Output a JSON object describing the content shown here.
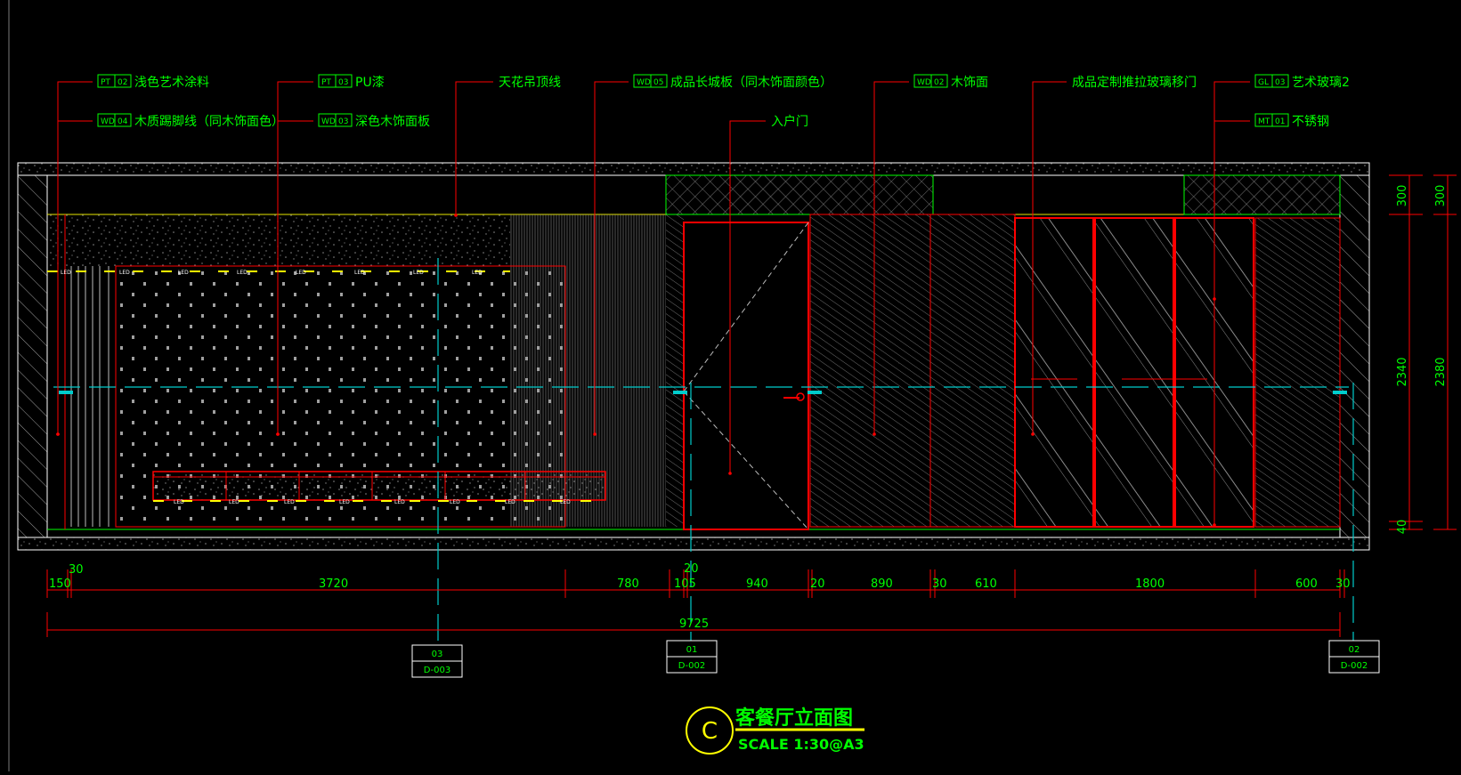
{
  "drawing": {
    "title": "客餐厅立面图",
    "scale": "SCALE 1:30@A3",
    "section_letter": "C",
    "led_label": "LED"
  },
  "callouts": [
    {
      "code": "PT",
      "num": "02",
      "text": "浅色艺术涂料"
    },
    {
      "code": "WD",
      "num": "04",
      "text": "木质踢脚线（同木饰面色）"
    },
    {
      "code": "PT",
      "num": "03",
      "text": "PU漆"
    },
    {
      "code": "WD",
      "num": "03",
      "text": "深色木饰面板"
    },
    {
      "code": "",
      "num": "",
      "text": "天花吊顶线"
    },
    {
      "code": "WD",
      "num": "05",
      "text": "成品长城板（同木饰面颜色）"
    },
    {
      "code": "",
      "num": "",
      "text": "入户门"
    },
    {
      "code": "WD",
      "num": "02",
      "text": "木饰面"
    },
    {
      "code": "",
      "num": "",
      "text": "成品定制推拉玻璃移门"
    },
    {
      "code": "GL",
      "num": "03",
      "text": "艺术玻璃2"
    },
    {
      "code": "MT",
      "num": "01",
      "text": "不锈钢"
    }
  ],
  "dimensions": {
    "horizontal": [
      "150",
      "30",
      "3720",
      "780",
      "105",
      "20",
      "940",
      "20",
      "890",
      "30",
      "610",
      "1800",
      "600",
      "30"
    ],
    "total": "9725",
    "vertical_inner": [
      "300",
      "2340",
      "40"
    ],
    "vertical_outer": [
      "300",
      "2380"
    ]
  },
  "section_refs": [
    {
      "num": "03",
      "sheet": "D-003"
    },
    {
      "num": "01",
      "sheet": "D-002"
    },
    {
      "num": "02",
      "sheet": "D-002"
    }
  ],
  "colors": {
    "background": "#000000",
    "annotation": "#00ff00",
    "outline": "#ffffff",
    "detail": "#ff0000",
    "centerline": "#00cccc",
    "led": "#ffff00",
    "hatch": "#9a9a9a"
  }
}
